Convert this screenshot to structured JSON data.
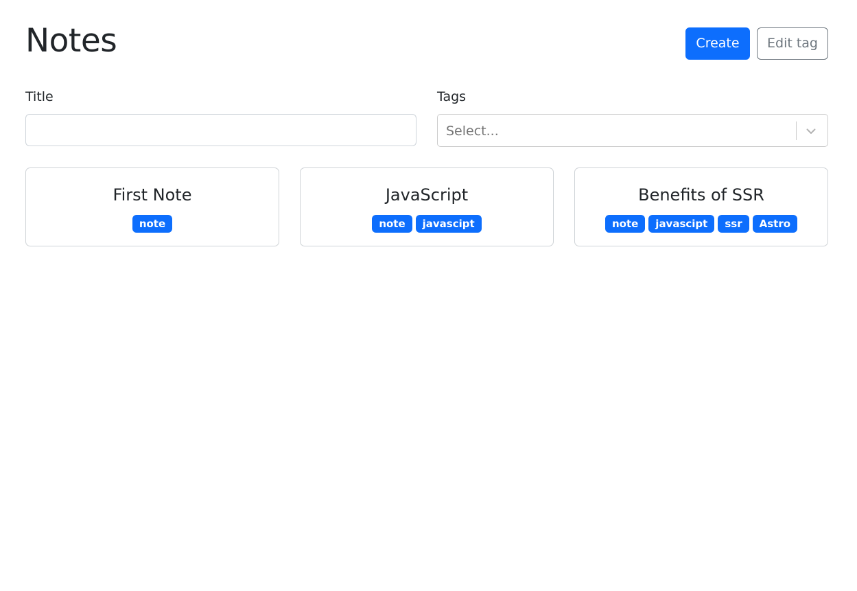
{
  "header": {
    "title": "Notes",
    "create_label": "Create",
    "edit_tag_label": "Edit tag"
  },
  "filters": {
    "title_label": "Title",
    "title_value": "",
    "tags_label": "Tags",
    "tags_placeholder": "Select..."
  },
  "notes": [
    {
      "title": "First Note",
      "tags": [
        "note"
      ]
    },
    {
      "title": "JavaScript",
      "tags": [
        "note",
        "javascipt"
      ]
    },
    {
      "title": "Benefits of SSR",
      "tags": [
        "note",
        "javascipt",
        "ssr",
        "Astro"
      ]
    }
  ],
  "colors": {
    "primary": "#0d6efd",
    "secondary": "#6c757d",
    "text": "#212529"
  },
  "icons": {
    "select_dropdown": "chevron-down-icon"
  }
}
